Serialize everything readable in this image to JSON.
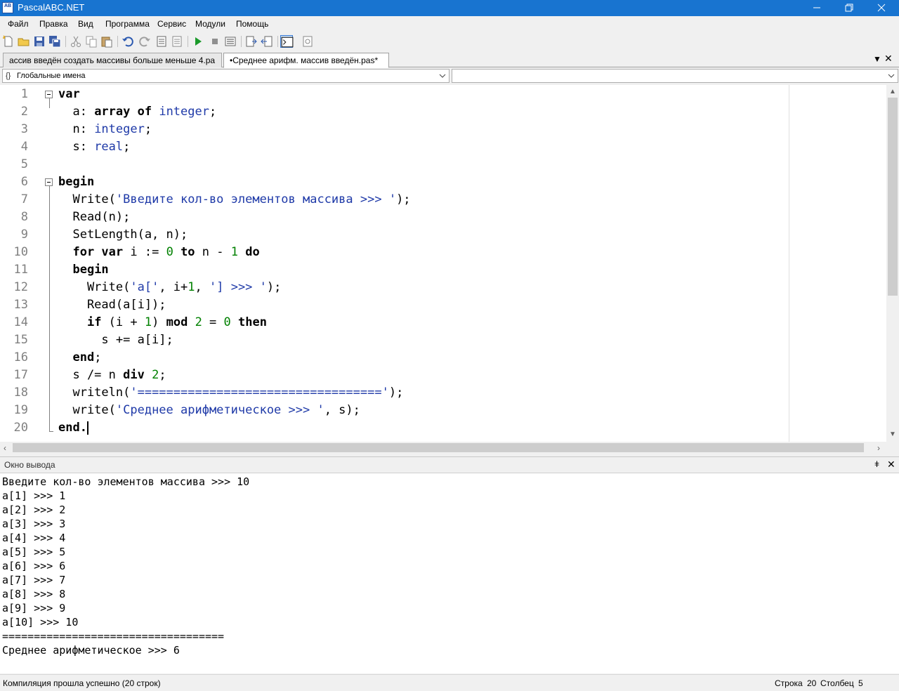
{
  "window": {
    "title": "PascalABC.NET",
    "icon_label": "AB"
  },
  "menu": [
    "Файл",
    "Правка",
    "Вид",
    "Программа",
    "Сервис",
    "Модули",
    "Помощь"
  ],
  "tabs": [
    {
      "label": "ассив введён создать массивы больше меньше 4.pa",
      "active": false
    },
    {
      "label": "•Среднее арифм. массив введён.pas*",
      "active": true
    }
  ],
  "combos": {
    "left": "Глобальные имена",
    "left_icon": "{}",
    "right": ""
  },
  "editor": {
    "line_numbers": [
      "1",
      "2",
      "3",
      "4",
      "5",
      "6",
      "7",
      "8",
      "9",
      "10",
      "11",
      "12",
      "13",
      "14",
      "15",
      "16",
      "17",
      "18",
      "19",
      "20"
    ],
    "lines": [
      [
        {
          "t": "var",
          "c": "kw"
        }
      ],
      [
        {
          "t": "  a: "
        },
        {
          "t": "array of",
          "c": "kw"
        },
        {
          "t": " "
        },
        {
          "t": "integer",
          "c": "ty"
        },
        {
          "t": ";"
        }
      ],
      [
        {
          "t": "  n: "
        },
        {
          "t": "integer",
          "c": "ty"
        },
        {
          "t": ";"
        }
      ],
      [
        {
          "t": "  s: "
        },
        {
          "t": "real",
          "c": "ty"
        },
        {
          "t": ";"
        }
      ],
      [
        {
          "t": ""
        }
      ],
      [
        {
          "t": "begin",
          "c": "kw"
        }
      ],
      [
        {
          "t": "  Write("
        },
        {
          "t": "'Введите кол-во элементов массива >>> '",
          "c": "st"
        },
        {
          "t": ");"
        }
      ],
      [
        {
          "t": "  Read(n);"
        }
      ],
      [
        {
          "t": "  SetLength(a, n);"
        }
      ],
      [
        {
          "t": "  "
        },
        {
          "t": "for var",
          "c": "kw"
        },
        {
          "t": " i := "
        },
        {
          "t": "0",
          "c": "nm"
        },
        {
          "t": " "
        },
        {
          "t": "to",
          "c": "kw"
        },
        {
          "t": " n - "
        },
        {
          "t": "1",
          "c": "nm"
        },
        {
          "t": " "
        },
        {
          "t": "do",
          "c": "kw"
        }
      ],
      [
        {
          "t": "  "
        },
        {
          "t": "begin",
          "c": "kw"
        }
      ],
      [
        {
          "t": "    Write("
        },
        {
          "t": "'a['",
          "c": "st"
        },
        {
          "t": ", i+"
        },
        {
          "t": "1",
          "c": "nm"
        },
        {
          "t": ", "
        },
        {
          "t": "'] >>> '",
          "c": "st"
        },
        {
          "t": ");"
        }
      ],
      [
        {
          "t": "    Read(a[i]);"
        }
      ],
      [
        {
          "t": "    "
        },
        {
          "t": "if",
          "c": "kw"
        },
        {
          "t": " (i + "
        },
        {
          "t": "1",
          "c": "nm"
        },
        {
          "t": ") "
        },
        {
          "t": "mod",
          "c": "kw"
        },
        {
          "t": " "
        },
        {
          "t": "2",
          "c": "nm"
        },
        {
          "t": " = "
        },
        {
          "t": "0",
          "c": "nm"
        },
        {
          "t": " "
        },
        {
          "t": "then",
          "c": "kw"
        }
      ],
      [
        {
          "t": "      s += a[i];"
        }
      ],
      [
        {
          "t": "  "
        },
        {
          "t": "end",
          "c": "kw"
        },
        {
          "t": ";"
        }
      ],
      [
        {
          "t": "  s /= n "
        },
        {
          "t": "div",
          "c": "kw"
        },
        {
          "t": " "
        },
        {
          "t": "2",
          "c": "nm"
        },
        {
          "t": ";"
        }
      ],
      [
        {
          "t": "  writeln("
        },
        {
          "t": "'=================================='",
          "c": "st"
        },
        {
          "t": ");"
        }
      ],
      [
        {
          "t": "  write("
        },
        {
          "t": "'Среднее арифметическое >>> '",
          "c": "st"
        },
        {
          "t": ", s);"
        }
      ],
      [
        {
          "t": "end.",
          "c": "kw"
        }
      ]
    ]
  },
  "output_panel": {
    "title": "Окно вывода",
    "lines": [
      "Введите кол-во элементов массива >>> 10",
      "a[1] >>> 1",
      "a[2] >>> 2",
      "a[3] >>> 3",
      "a[4] >>> 4",
      "a[5] >>> 5",
      "a[6] >>> 6",
      "a[7] >>> 7",
      "a[8] >>> 8",
      "a[9] >>> 9",
      "a[10] >>> 10",
      "===================================",
      "Среднее арифметическое >>> 6"
    ]
  },
  "status": {
    "message": "Компиляция прошла успешно (20 строк)",
    "row_label": "Строка",
    "row_value": "20",
    "col_label": "Столбец",
    "col_value": "5"
  },
  "toolbar_icons": [
    "new-file-icon",
    "open-icon",
    "save-icon",
    "save-all-icon",
    "cut-icon",
    "copy-icon",
    "paste-icon",
    "undo-icon",
    "redo-icon",
    "unindent-icon",
    "indent-icon",
    "run-icon",
    "stop-icon",
    "compile-icon",
    "step-into-icon",
    "step-over-icon",
    "output-window-icon",
    "debug-form-icon"
  ],
  "colors": {
    "titlebar": "#1874d0",
    "keyword": "#000000",
    "type": "#1f3aa8",
    "string": "#1f3aa8",
    "number": "#008000"
  }
}
